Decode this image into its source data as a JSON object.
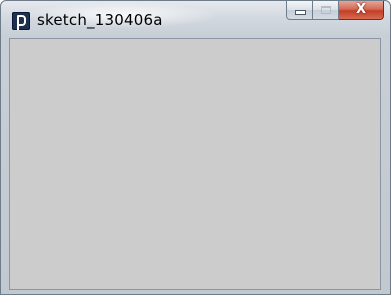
{
  "window": {
    "title": "sketch_130406a",
    "app_icon": "processing-app-icon",
    "controls": {
      "minimize_icon": "minimize-icon",
      "maximize_icon": "maximize-icon",
      "close_icon": "close-icon",
      "close_label": "X"
    }
  },
  "canvas": {
    "background_color": "#cccccc"
  }
}
